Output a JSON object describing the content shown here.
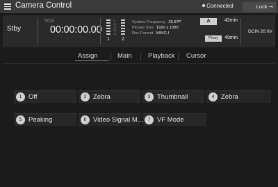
{
  "titlebar": {
    "title": "Camera Control",
    "connection": "Connected",
    "lock_label": "Lock"
  },
  "status": {
    "mode": "Stby",
    "tc_label": "TCG",
    "timecode": "00:00:00.00",
    "meter_scale": [
      "0",
      "10",
      "20",
      "30",
      "40"
    ],
    "channels": [
      "1",
      "2"
    ],
    "system_frequency_label": "System Frequency",
    "system_frequency": "29.97P",
    "picture_size_label": "Picture Size",
    "picture_size": "1920 x 1080",
    "rec_format_label": "Rec Format",
    "rec_format": "XAVC-I",
    "media_a_label": "A",
    "media_a_remaining": "42min",
    "proxy_label": "Proxy",
    "proxy_remaining": "49min",
    "power": "DCIN 20.0V"
  },
  "tabs": [
    {
      "label": "Assign",
      "active": true
    },
    {
      "label": "Main",
      "active": false
    },
    {
      "label": "Playback",
      "active": false
    },
    {
      "label": "Cursor",
      "active": false
    }
  ],
  "assign_buttons": [
    {
      "num": "1",
      "label": "Off"
    },
    {
      "num": "2",
      "label": "Zebra"
    },
    {
      "num": "3",
      "label": "Thumbnail"
    },
    {
      "num": "4",
      "label": "Zebra"
    },
    {
      "num": "5",
      "label": "Peaking"
    },
    {
      "num": "6",
      "label": "Video Signal M..."
    },
    {
      "num": "7",
      "label": "VF Mode"
    }
  ]
}
